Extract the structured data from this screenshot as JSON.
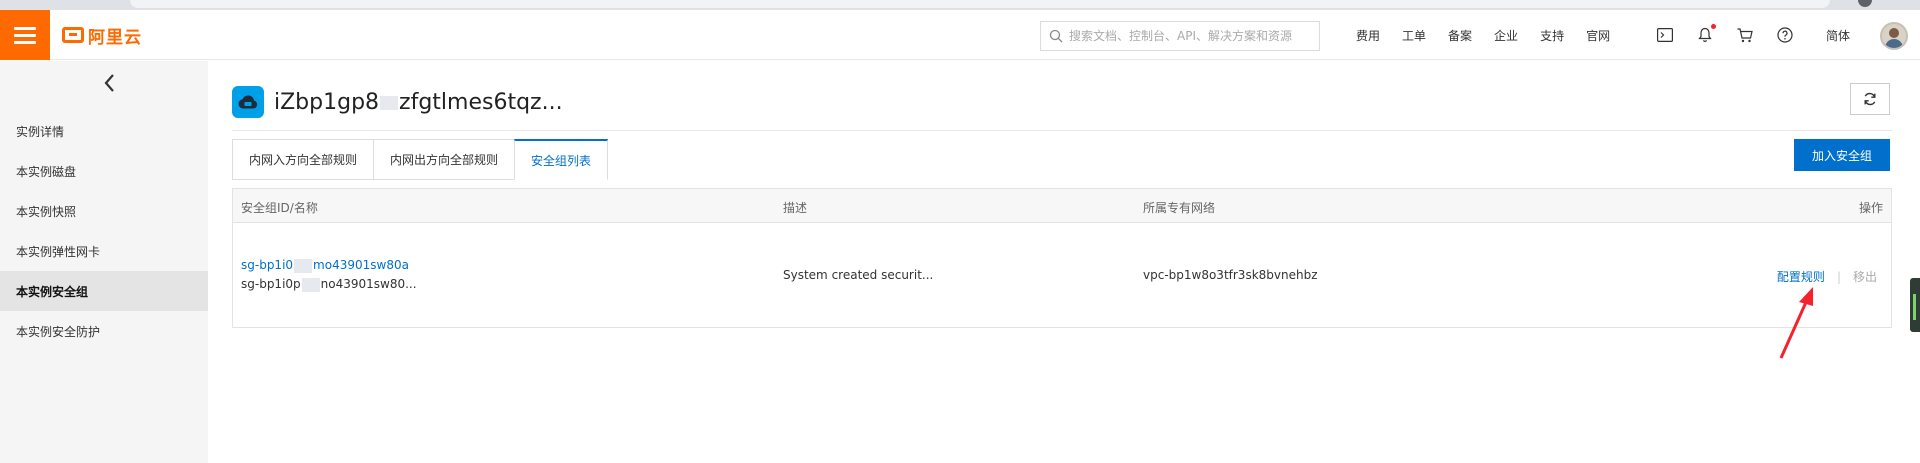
{
  "topbar": {
    "logo_text": "阿里云",
    "search_placeholder": "搜索文档、控制台、API、解决方案和资源",
    "nav_links": [
      "费用",
      "工单",
      "备案",
      "企业",
      "支持",
      "官网"
    ],
    "icons": [
      "terminal-icon",
      "bell-icon",
      "cart-icon",
      "help-icon"
    ],
    "language": "简体",
    "accent_color": "#ff6a00"
  },
  "sidebar": {
    "items": [
      {
        "label": "实例详情",
        "active": false
      },
      {
        "label": "本实例磁盘",
        "active": false
      },
      {
        "label": "本实例快照",
        "active": false
      },
      {
        "label": "本实例弹性网卡",
        "active": false
      },
      {
        "label": "本实例安全组",
        "active": true
      },
      {
        "label": "本实例安全防护",
        "active": false
      }
    ]
  },
  "main": {
    "instance_title": "iZbp1gp8",
    "instance_title_suffix": "zfgtlmes6tqz...",
    "tabs": [
      {
        "label": "内网入方向全部规则",
        "active": false
      },
      {
        "label": "内网出方向全部规则",
        "active": false
      },
      {
        "label": "安全组列表",
        "active": true
      }
    ],
    "add_button_label": "加入安全组",
    "table": {
      "headers": {
        "id_name": "安全组ID/名称",
        "desc": "描述",
        "vpc": "所属专有网络",
        "ops": "操作"
      },
      "rows": [
        {
          "id_prefix": "sg-bp1i0",
          "id_suffix": "mo43901sw80a",
          "name_prefix": "sg-bp1i0p",
          "name_suffix": "no43901sw80...",
          "desc": "System created securit...",
          "vpc": "vpc-bp1w8o3tfr3sk8bvnehbz",
          "op_config": "配置规则",
          "op_remove": "移出"
        }
      ]
    }
  },
  "colors": {
    "primary": "#0070cc",
    "annotation": "#f5222d"
  }
}
